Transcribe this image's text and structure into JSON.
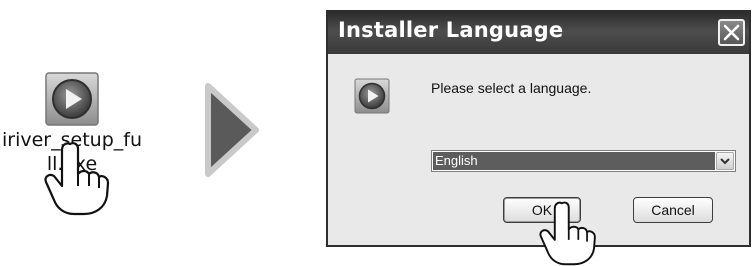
{
  "desktop": {
    "file_label": "iriver_setup_full.exe",
    "icon": "media-play-icon"
  },
  "dialog": {
    "title": "Installer Language",
    "close_icon": "close-icon",
    "prompt": "Please select a language.",
    "language_select": {
      "selected": "English"
    },
    "ok_label": "OK",
    "cancel_label": "Cancel"
  },
  "overlays": {
    "step_arrow": "right-arrow-icon",
    "pointer": "hand-pointer-icon"
  }
}
